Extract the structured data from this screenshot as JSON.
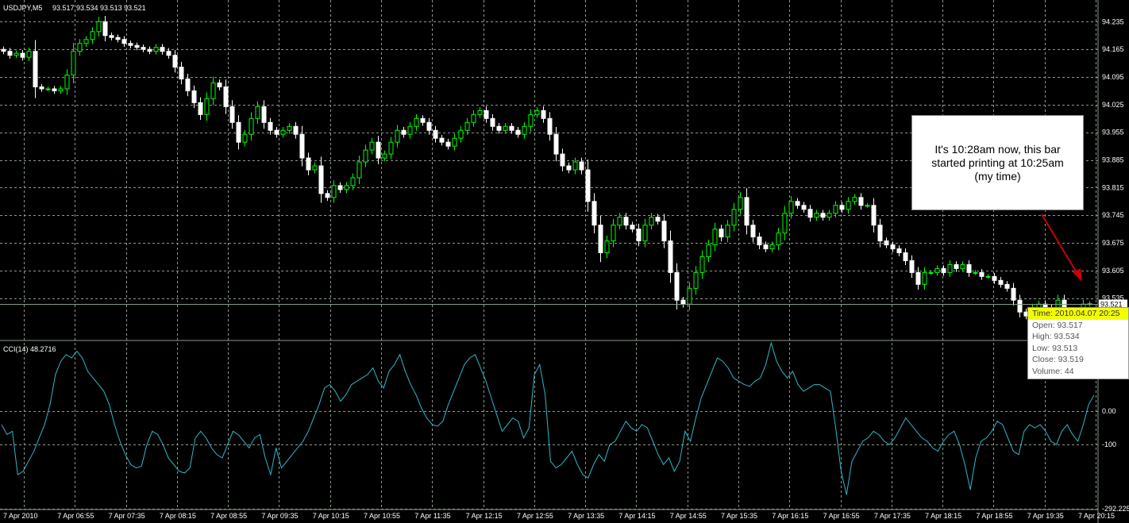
{
  "header": {
    "symbol_label": "USDJPY,M5",
    "ohlc_label": "93.517 93.534 93.513 93.521",
    "indicator_label": "CCI(14) 48.2716"
  },
  "colors": {
    "background": "#000000",
    "grid": "#8a9a8a",
    "bull_candle": "#00ff00",
    "bear_candle": "#ffffff",
    "cci_line": "#2fb8c8",
    "annotation_arrow": "#cc0000",
    "price_line": "#8a9a8a",
    "tooltip_highlight": "#f2ff00"
  },
  "annotation": {
    "text": "It's 10:28am now, this bar\nstarted printing at 10:25am\n(my time)"
  },
  "tooltip": {
    "time": "Time: 2010.04.07 20:25",
    "open": "Open: 93.517",
    "high": "High: 93.534",
    "low": "Low:  93.513",
    "close": "Close: 93.519",
    "volume": "Volume: 44"
  },
  "price_marker": {
    "current": "93.521"
  },
  "chart_data": [
    {
      "type": "candlestick",
      "title": "USDJPY,M5",
      "yticks": [
        "94.235",
        "94.165",
        "94.095",
        "94.025",
        "93.955",
        "93.885",
        "93.815",
        "93.745",
        "93.675",
        "93.605",
        "93.535"
      ],
      "ylim": [
        93.43,
        94.29
      ],
      "xticks": [
        "7 Apr 2010",
        "7 Apr 06:55",
        "7 Apr 07:35",
        "7 Apr 08:15",
        "7 Apr 08:55",
        "7 Apr 09:35",
        "7 Apr 10:15",
        "7 Apr 10:55",
        "7 Apr 11:35",
        "7 Apr 12:15",
        "7 Apr 12:55",
        "7 Apr 13:35",
        "7 Apr 14:15",
        "7 Apr 14:55",
        "7 Apr 15:35",
        "7 Apr 16:15",
        "7 Apr 16:55",
        "7 Apr 17:35",
        "7 Apr 18:15",
        "7 Apr 18:55",
        "7 Apr 19:35",
        "7 Apr 20:15"
      ],
      "close": [
        94.16,
        94.15,
        94.155,
        94.145,
        94.16,
        94.07,
        94.065,
        94.065,
        94.06,
        94.065,
        94.1,
        94.16,
        94.18,
        94.19,
        94.21,
        94.235,
        94.2,
        94.195,
        94.19,
        94.18,
        94.175,
        94.17,
        94.165,
        94.16,
        94.17,
        94.16,
        94.15,
        94.12,
        94.09,
        94.06,
        94.03,
        94.0,
        94.04,
        94.08,
        94.07,
        94.02,
        93.98,
        93.93,
        93.95,
        93.99,
        94.02,
        93.98,
        93.96,
        93.95,
        93.96,
        93.97,
        93.95,
        93.89,
        93.86,
        93.87,
        93.8,
        93.79,
        93.82,
        93.81,
        93.82,
        93.84,
        93.88,
        93.91,
        93.93,
        93.89,
        93.9,
        93.93,
        93.96,
        93.95,
        93.97,
        93.99,
        93.98,
        93.96,
        93.94,
        93.93,
        93.92,
        93.94,
        93.96,
        93.98,
        94.0,
        94.01,
        93.99,
        93.97,
        93.96,
        93.97,
        93.96,
        93.95,
        93.97,
        94.0,
        94.01,
        93.99,
        93.95,
        93.9,
        93.87,
        93.86,
        93.88,
        93.86,
        93.78,
        93.72,
        93.65,
        93.68,
        93.72,
        93.74,
        93.72,
        93.71,
        93.68,
        93.72,
        93.74,
        93.73,
        93.68,
        93.6,
        93.53,
        93.52,
        93.56,
        93.6,
        93.64,
        93.67,
        93.71,
        93.69,
        93.72,
        93.76,
        93.79,
        93.72,
        93.69,
        93.67,
        93.66,
        93.67,
        93.7,
        93.75,
        93.78,
        93.77,
        93.76,
        93.74,
        93.75,
        93.74,
        93.75,
        93.77,
        93.76,
        93.78,
        93.79,
        93.77,
        93.77,
        93.72,
        93.68,
        93.67,
        93.66,
        93.65,
        93.63,
        93.6,
        93.57,
        93.6,
        93.6,
        93.61,
        93.6,
        93.62,
        93.61,
        93.62,
        93.6,
        93.6,
        93.59,
        93.59,
        93.58,
        93.57,
        93.56,
        93.53,
        93.5,
        93.49,
        93.51,
        93.52,
        93.51,
        93.5,
        93.53,
        93.5,
        93.49,
        93.5,
        93.52,
        93.521
      ]
    },
    {
      "type": "line",
      "title": "CCI(14)",
      "series": [
        {
          "name": "CCI(14)",
          "values": [
            -40,
            -70,
            -60,
            -190,
            -180,
            -150,
            -120,
            -80,
            -40,
            20,
            110,
            150,
            170,
            160,
            180,
            160,
            120,
            100,
            80,
            60,
            20,
            -40,
            -90,
            -130,
            -160,
            -170,
            -165,
            -100,
            -60,
            -70,
            -100,
            -140,
            -160,
            -180,
            -185,
            -170,
            -80,
            -60,
            -80,
            -110,
            -130,
            -140,
            -100,
            -60,
            -70,
            -90,
            -110,
            -80,
            -70,
            -140,
            -190,
            -110,
            -170,
            -150,
            -130,
            -110,
            -90,
            -60,
            -20,
            20,
            70,
            80,
            60,
            30,
            50,
            80,
            90,
            100,
            110,
            130,
            90,
            70,
            120,
            140,
            170,
            120,
            80,
            50,
            10,
            -20,
            -40,
            -45,
            -30,
            20,
            60,
            100,
            140,
            160,
            170,
            130,
            90,
            40,
            -10,
            -60,
            -40,
            -20,
            -30,
            -80,
            -50,
            110,
            140,
            50,
            -150,
            -170,
            -160,
            -140,
            -120,
            -160,
            -190,
            -200,
            -160,
            -130,
            -150,
            -100,
            -90,
            -60,
            -30,
            -50,
            -60,
            -40,
            -50,
            -90,
            -130,
            -160,
            -140,
            -180,
            -150,
            -60,
            -90,
            -20,
            40,
            80,
            120,
            160,
            150,
            130,
            100,
            90,
            80,
            75,
            90,
            100,
            140,
            205,
            150,
            120,
            100,
            120,
            80,
            60,
            70,
            80,
            80,
            70,
            60,
            -50,
            -180,
            -250,
            -150,
            -120,
            -90,
            -80,
            -60,
            -70,
            -90,
            -100,
            -80,
            -50,
            -20,
            -40,
            -60,
            -80,
            -90,
            -110,
            -120,
            -90,
            -70,
            -60,
            -100,
            -160,
            -235,
            -140,
            -90,
            -80,
            -60,
            -30,
            -40,
            -80,
            -120,
            -130,
            -60,
            -40,
            -50,
            -40,
            -60,
            -90,
            -100,
            -60,
            -40,
            -70,
            -90,
            -40,
            20,
            48.27
          ]
        }
      ],
      "yticks": [
        "0.00",
        "-100",
        "-292.225"
      ],
      "ylim": [
        -292.225,
        210
      ]
    }
  ]
}
